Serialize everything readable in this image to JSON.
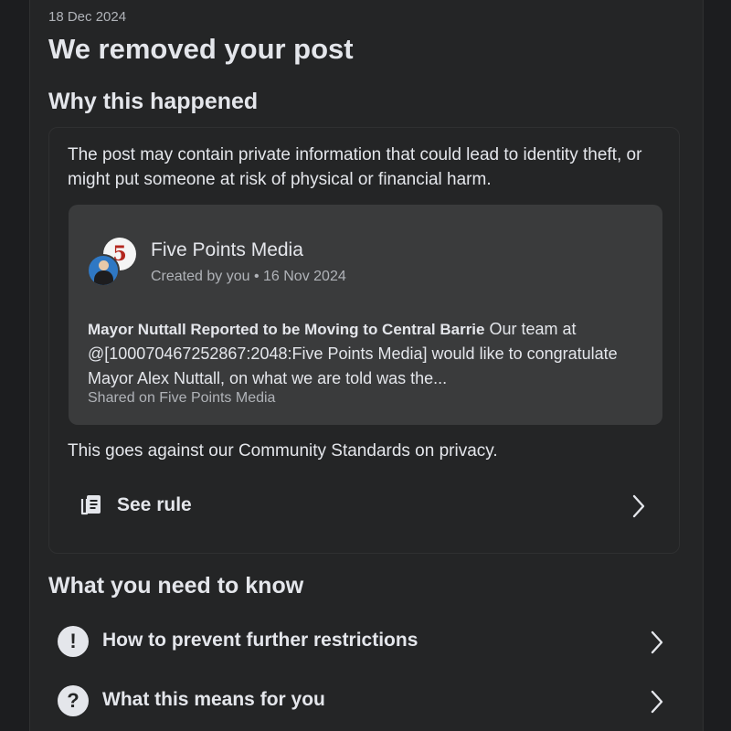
{
  "header": {
    "date": "18 Dec 2024",
    "title": "We removed your post"
  },
  "why": {
    "heading": "Why this happened",
    "reason": "The post may contain private information that could lead to identity theft, or might put someone at risk of physical or financial harm.",
    "post": {
      "page_name": "Five Points Media",
      "page_avatar_glyph": "5",
      "meta": "Created by you • 16 Nov 2024",
      "headline": "Mayor Nuttall Reported to be Moving to Central Barrie",
      "body": "Our team at @[100070467252867:2048:Five Points Media] would like to congratulate Mayor Alex Nuttall, on what we are told was the...",
      "shared_on": "Shared on Five Points Media"
    },
    "standards": "This goes against our Community Standards on privacy.",
    "see_rule_label": "See rule"
  },
  "know": {
    "heading": "What you need to know",
    "items": [
      {
        "label": "How to prevent further restrictions",
        "icon": "!"
      },
      {
        "label": "What this means for you",
        "icon": "?"
      }
    ]
  }
}
